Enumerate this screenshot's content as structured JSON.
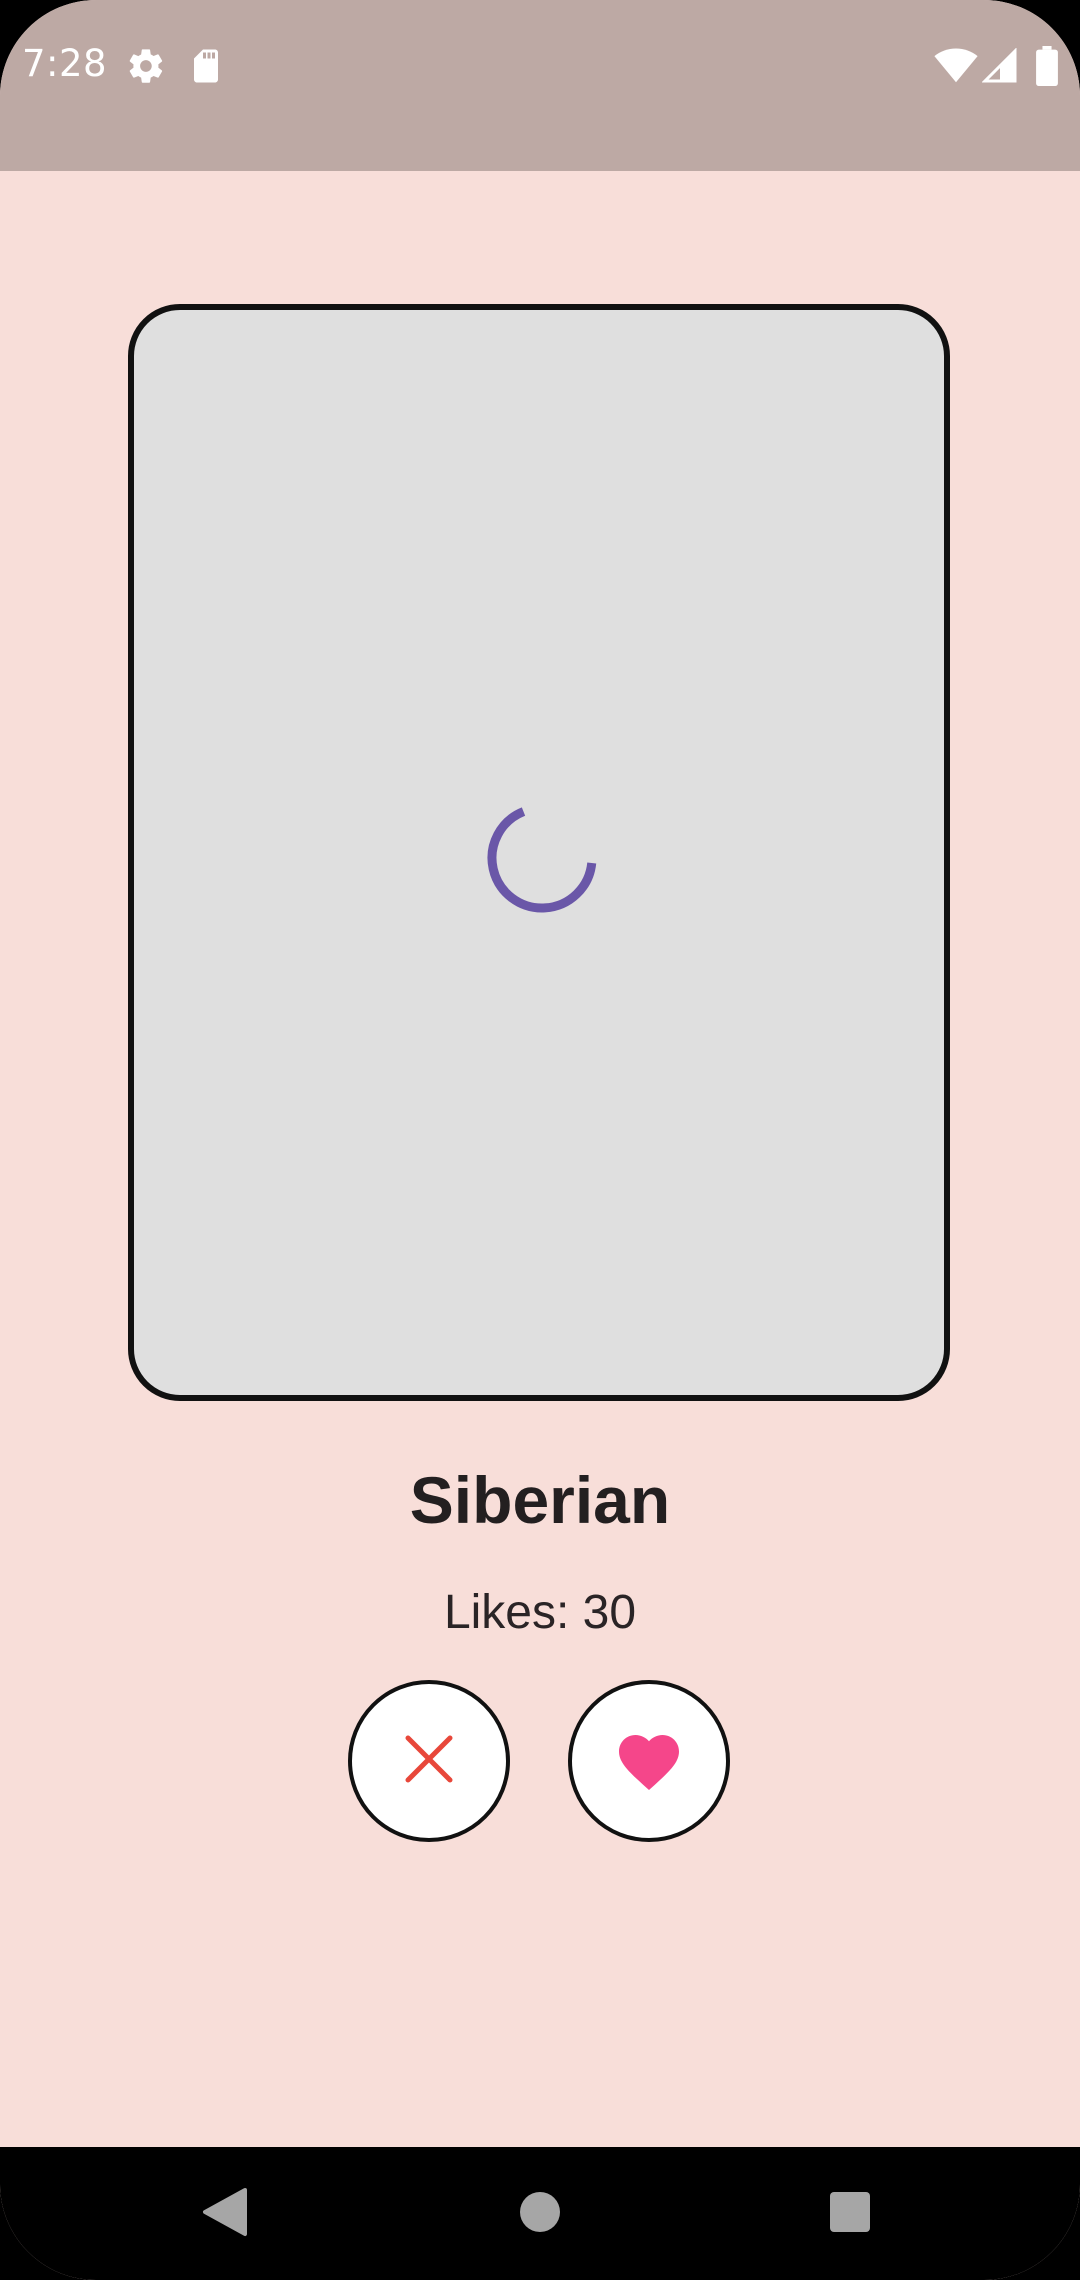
{
  "status_bar": {
    "time": "7:28",
    "icons": [
      "settings-gear-icon",
      "sd-card-icon",
      "wifi-icon",
      "cell-signal-icon",
      "battery-icon"
    ]
  },
  "card": {
    "loading_state": "spinner"
  },
  "breed": {
    "name": "Siberian",
    "likes_text": "Likes: 30"
  },
  "actions": {
    "dislike_icon": "close-icon",
    "like_icon": "heart-icon"
  },
  "nav_bar": {
    "buttons": [
      "back-icon",
      "home-icon",
      "recents-icon"
    ]
  },
  "colors": {
    "background": "#f8ded9",
    "status_bar": "#bda9a4",
    "card_fill": "#dfdfdf",
    "spinner": "#6a57a8",
    "dislike": "#e8473a",
    "like": "#f5468a"
  }
}
